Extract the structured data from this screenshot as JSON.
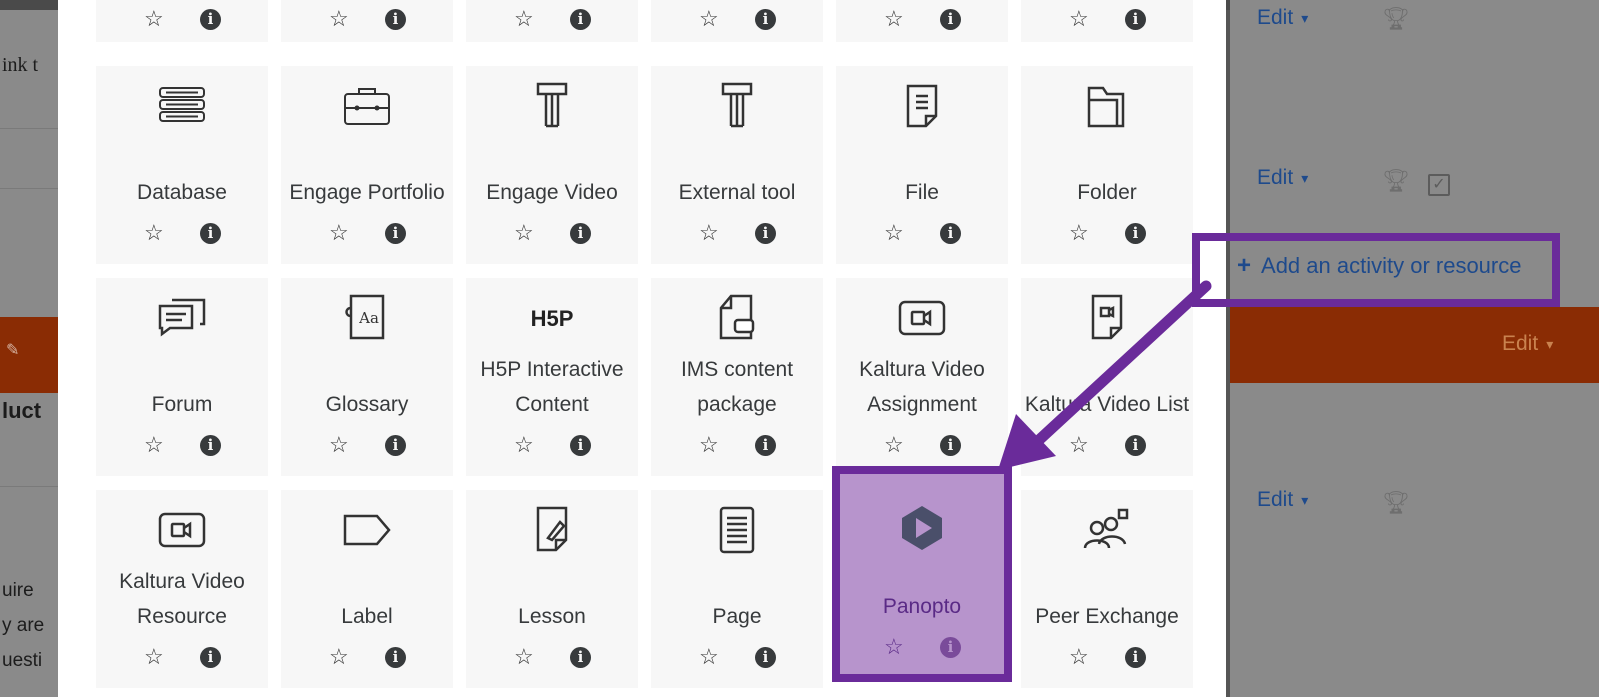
{
  "background_left": {
    "text_top": "ink t",
    "text_section": "luct",
    "text_line1": "uire",
    "text_line2": "y are",
    "text_line3": "uesti",
    "pen_icon": "pencil-icon"
  },
  "background_right": {
    "edit_label": "Edit",
    "add_activity_label": "Add an activity or resource",
    "colors": {
      "link": "#1e4a8c",
      "section_orange": "#8a2c04"
    }
  },
  "modal": {
    "rows": [
      {
        "tiles": [
          "",
          "",
          "",
          "",
          "",
          ""
        ]
      },
      {
        "tiles": [
          {
            "name": "Database",
            "icon": "database-icon"
          },
          {
            "name": "Engage Portfolio",
            "icon": "portfolio-icon"
          },
          {
            "name": "Engage Video",
            "icon": "engage-video-icon"
          },
          {
            "name": "External tool",
            "icon": "external-tool-icon"
          },
          {
            "name": "File",
            "icon": "file-icon"
          },
          {
            "name": "Folder",
            "icon": "folder-icon"
          }
        ]
      },
      {
        "tiles": [
          {
            "name": "Forum",
            "icon": "forum-icon"
          },
          {
            "name": "Glossary",
            "icon": "glossary-icon"
          },
          {
            "name": "H5P Interactive Content",
            "icon": "h5p-icon"
          },
          {
            "name": "IMS content package",
            "icon": "ims-package-icon"
          },
          {
            "name": "Kaltura Video Assignment",
            "icon": "kaltura-video-icon"
          },
          {
            "name": "Kaltura Video List",
            "icon": "kaltura-video-list-icon"
          }
        ]
      },
      {
        "tiles": [
          {
            "name": "Kaltura Video Resource",
            "icon": "kaltura-video-icon"
          },
          {
            "name": "Label",
            "icon": "label-icon"
          },
          {
            "name": "Lesson",
            "icon": "lesson-icon"
          },
          {
            "name": "Page",
            "icon": "page-icon"
          },
          {
            "name": "Panopto",
            "icon": "panopto-icon"
          },
          {
            "name": "Peer Exchange",
            "icon": "peer-exchange-icon"
          }
        ]
      }
    ],
    "star_glyph": "☆",
    "info_glyph": "i",
    "highlight_color": "#6a2b9a"
  }
}
